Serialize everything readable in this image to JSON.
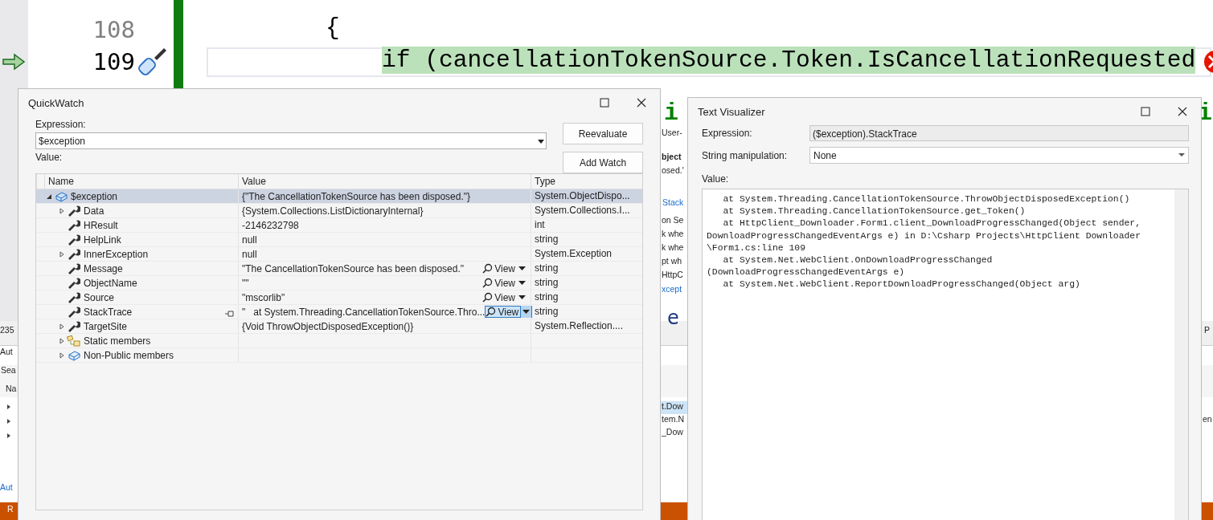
{
  "editor": {
    "lines": [
      {
        "number": "108",
        "current": false,
        "segments": [
          {
            "text": "{",
            "kind": "plain"
          }
        ]
      },
      {
        "number": "109",
        "current": true,
        "segments": [
          {
            "text": "if (cancellationTokenSource.Token.IsCancellationRequested",
            "kind": "plain"
          }
        ]
      }
    ]
  },
  "background": {
    "fragments": [
      {
        "text": "i",
        "kind": "code"
      },
      {
        "text": "i",
        "kind": "code"
      },
      {
        "text": "User-",
        "kind": "label"
      },
      {
        "text": "bject",
        "kind": "bold"
      },
      {
        "text": "osed.'",
        "kind": "label"
      },
      {
        "text": "Stack",
        "kind": "link"
      },
      {
        "text": "on Se",
        "kind": "label"
      },
      {
        "text": "k whe",
        "kind": "label"
      },
      {
        "text": "k whe",
        "kind": "label"
      },
      {
        "text": "pt wh",
        "kind": "label"
      },
      {
        "text": "HttpC",
        "kind": "label"
      },
      {
        "text": "xcept",
        "kind": "link"
      },
      {
        "text": "e",
        "kind": "big"
      },
      {
        "text": "235",
        "kind": "label"
      },
      {
        "text": "Aut",
        "kind": "label"
      },
      {
        "text": "Sea",
        "kind": "label"
      },
      {
        "text": "Na",
        "kind": "label"
      },
      {
        "text": "Aut",
        "kind": "link"
      },
      {
        "text": "R",
        "kind": "status"
      },
      {
        "text": "t.Dow",
        "kind": "label"
      },
      {
        "text": "tem.N",
        "kind": "label"
      },
      {
        "text": "_Dow",
        "kind": "label"
      },
      {
        "text": "P",
        "kind": "label"
      },
      {
        "text": "en",
        "kind": "label"
      }
    ]
  },
  "quickwatch": {
    "title": "QuickWatch",
    "expression_label": "Expression:",
    "expression": "$exception",
    "value_label": "Value:",
    "buttons": [
      "Reevaluate",
      "Add Watch"
    ],
    "columns": [
      "Name",
      "Value",
      "Type"
    ],
    "rows": [
      {
        "name": "$exception",
        "value": "{\"The CancellationTokenSource has been disposed.\"}",
        "type": "System.ObjectDispo...",
        "kind": "object",
        "expanded": true,
        "selected": true,
        "children": [
          {
            "name": "Data",
            "value": "{System.Collections.ListDictionaryInternal}",
            "type": "System.Collections.I...",
            "kind": "property",
            "expanded": false,
            "selected": false
          },
          {
            "name": "HResult",
            "value": "-2146232798",
            "type": "int",
            "kind": "property",
            "selected": false
          },
          {
            "name": "HelpLink",
            "value": "null",
            "type": "string",
            "kind": "property",
            "selected": false
          },
          {
            "name": "InnerException",
            "value": "null",
            "type": "System.Exception",
            "kind": "property",
            "expanded": false,
            "selected": false
          },
          {
            "name": "Message",
            "value": "\"The CancellationTokenSource has been disposed.\"",
            "type": "string",
            "kind": "property",
            "selected": false,
            "view": {
              "label": "View",
              "selected": false
            }
          },
          {
            "name": "ObjectName",
            "value": "\"\"",
            "type": "string",
            "kind": "property",
            "selected": false,
            "view": {
              "label": "View",
              "selected": false
            }
          },
          {
            "name": "Source",
            "value": "\"mscorlib\"",
            "type": "string",
            "kind": "property",
            "selected": false,
            "view": {
              "label": "View",
              "selected": false
            }
          },
          {
            "name": "StackTrace",
            "value": "\"   at System.Threading.CancellationTokenSource.Thro...",
            "type": "string",
            "kind": "property",
            "selected": false,
            "pinnable": true,
            "view": {
              "label": "View",
              "selected": true
            }
          },
          {
            "name": "TargetSite",
            "value": "{Void ThrowObjectDisposedException()}",
            "type": "System.Reflection....",
            "kind": "property",
            "expanded": false,
            "selected": false
          },
          {
            "name": "Static members",
            "kind": "static",
            "expanded": false,
            "selected": false
          },
          {
            "name": "Non-Public members",
            "kind": "nonpublic",
            "expanded": false,
            "selected": false
          }
        ]
      }
    ]
  },
  "text_visualizer": {
    "title": "Text Visualizer",
    "expression_label": "Expression:",
    "expression": "($exception).StackTrace",
    "manipulation_label": "String manipulation:",
    "manipulation": "None",
    "value_label": "Value:",
    "value_lines": [
      "   at System.Threading.CancellationTokenSource.ThrowObjectDisposedException()",
      "   at System.Threading.CancellationTokenSource.get_Token()",
      "   at HttpClient_Downloader.Form1.client_DownloadProgressChanged(Object sender,",
      "DownloadProgressChangedEventArgs e) in D:\\Csharp Projects\\HttpClient Downloader",
      "\\Form1.cs:line 109",
      "   at System.Net.WebClient.OnDownloadProgressChanged",
      "(DownloadProgressChangedEventArgs e)",
      "   at System.Net.WebClient.ReportDownloadProgressChanged(Object arg)"
    ]
  }
}
